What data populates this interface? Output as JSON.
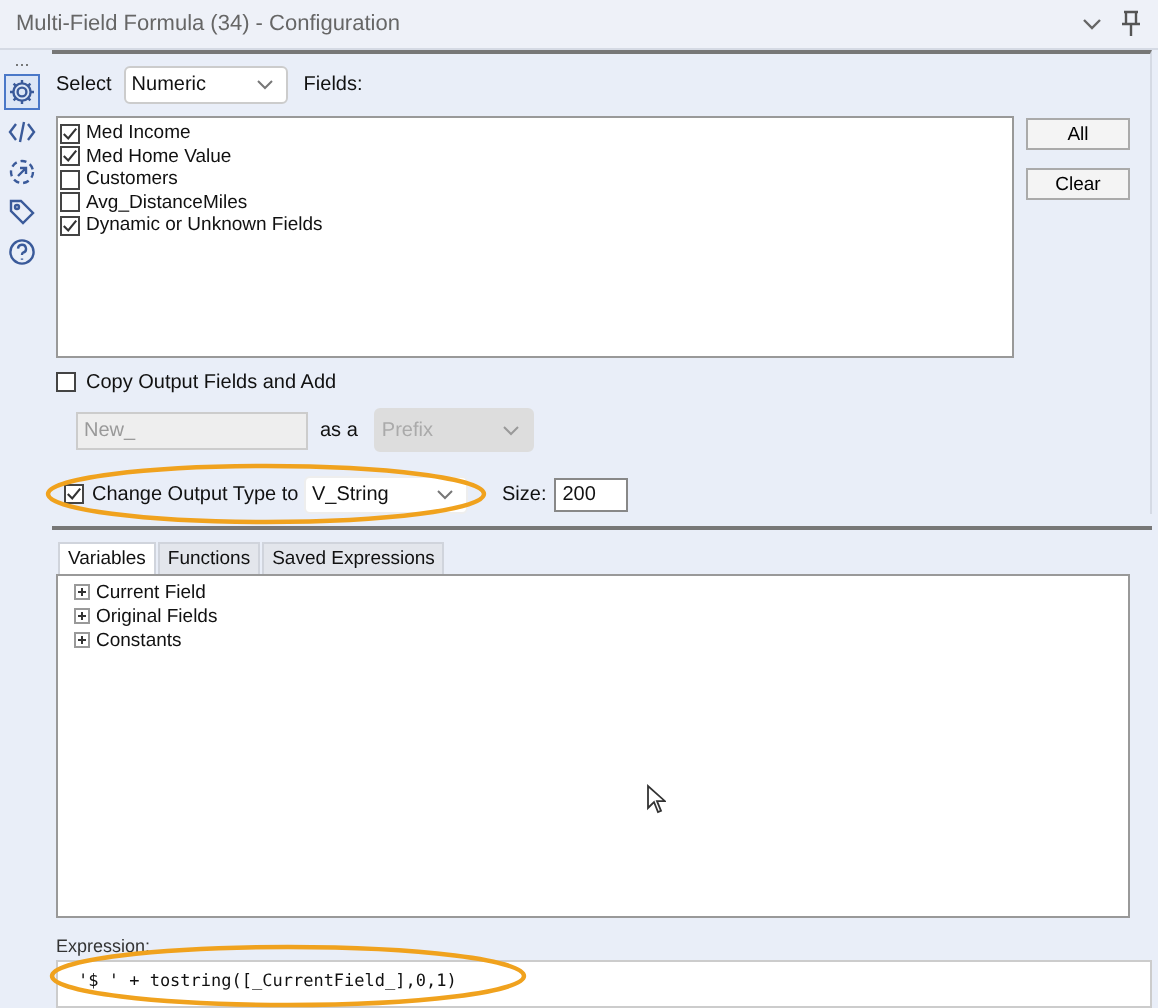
{
  "window": {
    "title": "Multi-Field Formula (34) - Configuration",
    "more": "..."
  },
  "rail": [
    {
      "kind": "gear",
      "selected": true
    },
    {
      "kind": "code",
      "selected": false
    },
    {
      "kind": "cycle",
      "selected": false
    },
    {
      "kind": "tag",
      "selected": false
    },
    {
      "kind": "help",
      "selected": false
    }
  ],
  "select": {
    "label": "Select",
    "value": "Numeric"
  },
  "fields_label": "Fields:",
  "fields": [
    {
      "name": "Med Income",
      "checked": true
    },
    {
      "name": "Med Home Value",
      "checked": true
    },
    {
      "name": "Customers",
      "checked": false
    },
    {
      "name": "Avg_DistanceMiles",
      "checked": false
    },
    {
      "name": "Dynamic or Unknown Fields",
      "checked": true
    }
  ],
  "buttons": [
    "All",
    "Clear"
  ],
  "copy_output": {
    "label": "Copy Output Fields and Add",
    "checked": false,
    "name_value": "New_",
    "as_label": "as a",
    "position": "Prefix",
    "disabled": true
  },
  "change_type": {
    "label": "Change Output Type to",
    "checked": true,
    "type": "V_String",
    "size_label": "Size:",
    "size": "200"
  },
  "tabs": [
    {
      "label": "Variables",
      "selected": true
    },
    {
      "label": "Functions",
      "selected": false
    },
    {
      "label": "Saved Expressions",
      "selected": false
    }
  ],
  "tree": [
    {
      "label": "Current Field",
      "expanded": false
    },
    {
      "label": "Original Fields",
      "expanded": false
    },
    {
      "label": "Constants",
      "expanded": false
    }
  ],
  "expression": {
    "label": "Expression:",
    "value": "'$ ' + tostring([_CurrentField_],0,1)"
  }
}
